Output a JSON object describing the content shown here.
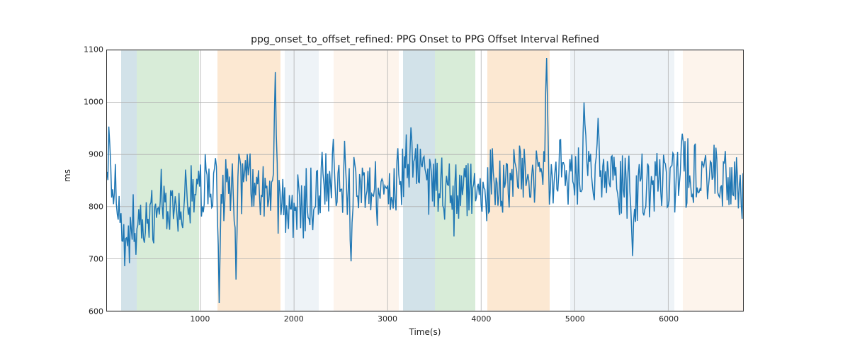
{
  "chart_data": {
    "type": "line",
    "title": "ppg_onset_to_offset_refined: PPG Onset to PPG Offset Interval Refined",
    "xlabel": "Time(s)",
    "ylabel": "ms",
    "xlim": [
      0,
      6800
    ],
    "ylim": [
      600,
      1100
    ],
    "xticks": [
      1000,
      2000,
      3000,
      4000,
      5000,
      6000
    ],
    "yticks": [
      600,
      700,
      800,
      900,
      1000,
      1100
    ],
    "series": [
      {
        "name": "ppg_onset_to_offset_refined",
        "color": "#1f77b4",
        "x_range": [
          0,
          6800
        ],
        "dt": 10,
        "baseline": 830,
        "noise_amp": 55,
        "spikes": [
          {
            "x": 1800,
            "y": 1058
          },
          {
            "x": 1200,
            "y": 615
          },
          {
            "x": 4700,
            "y": 1085
          },
          {
            "x": 5100,
            "y": 1000
          },
          {
            "x": 5250,
            "y": 970
          },
          {
            "x": 3250,
            "y": 952
          },
          {
            "x": 6150,
            "y": 940
          },
          {
            "x": 5620,
            "y": 705
          },
          {
            "x": 2420,
            "y": 930
          },
          {
            "x": 1380,
            "y": 660
          },
          {
            "x": 2610,
            "y": 695
          }
        ],
        "trend": [
          {
            "x": 0,
            "y": 910
          },
          {
            "x": 180,
            "y": 710
          },
          {
            "x": 400,
            "y": 790
          },
          {
            "x": 900,
            "y": 810
          },
          {
            "x": 1100,
            "y": 830
          },
          {
            "x": 1500,
            "y": 850
          },
          {
            "x": 2050,
            "y": 790
          },
          {
            "x": 2500,
            "y": 860
          },
          {
            "x": 3000,
            "y": 820
          },
          {
            "x": 3300,
            "y": 880
          },
          {
            "x": 3700,
            "y": 810
          },
          {
            "x": 4200,
            "y": 850
          },
          {
            "x": 4700,
            "y": 870
          },
          {
            "x": 5200,
            "y": 860
          },
          {
            "x": 5800,
            "y": 830
          },
          {
            "x": 6300,
            "y": 870
          },
          {
            "x": 6800,
            "y": 830
          }
        ]
      }
    ],
    "bands": [
      {
        "x0": 150,
        "x1": 320,
        "color": "#6a9fb5"
      },
      {
        "x0": 320,
        "x1": 980,
        "color": "#7fbf7f"
      },
      {
        "x0": 1180,
        "x1": 1850,
        "color": "#f5b26b"
      },
      {
        "x0": 1900,
        "x1": 2260,
        "color": "#c7d7e6"
      },
      {
        "x0": 2420,
        "x1": 3110,
        "color": "#f8dcc0"
      },
      {
        "x0": 3160,
        "x1": 3500,
        "color": "#6a9fb5"
      },
      {
        "x0": 3500,
        "x1": 3930,
        "color": "#7fbf7f"
      },
      {
        "x0": 4060,
        "x1": 4720,
        "color": "#f5b26b"
      },
      {
        "x0": 4940,
        "x1": 6050,
        "color": "#c7d7e6"
      },
      {
        "x0": 6140,
        "x1": 6800,
        "color": "#f8dcc0"
      }
    ]
  }
}
